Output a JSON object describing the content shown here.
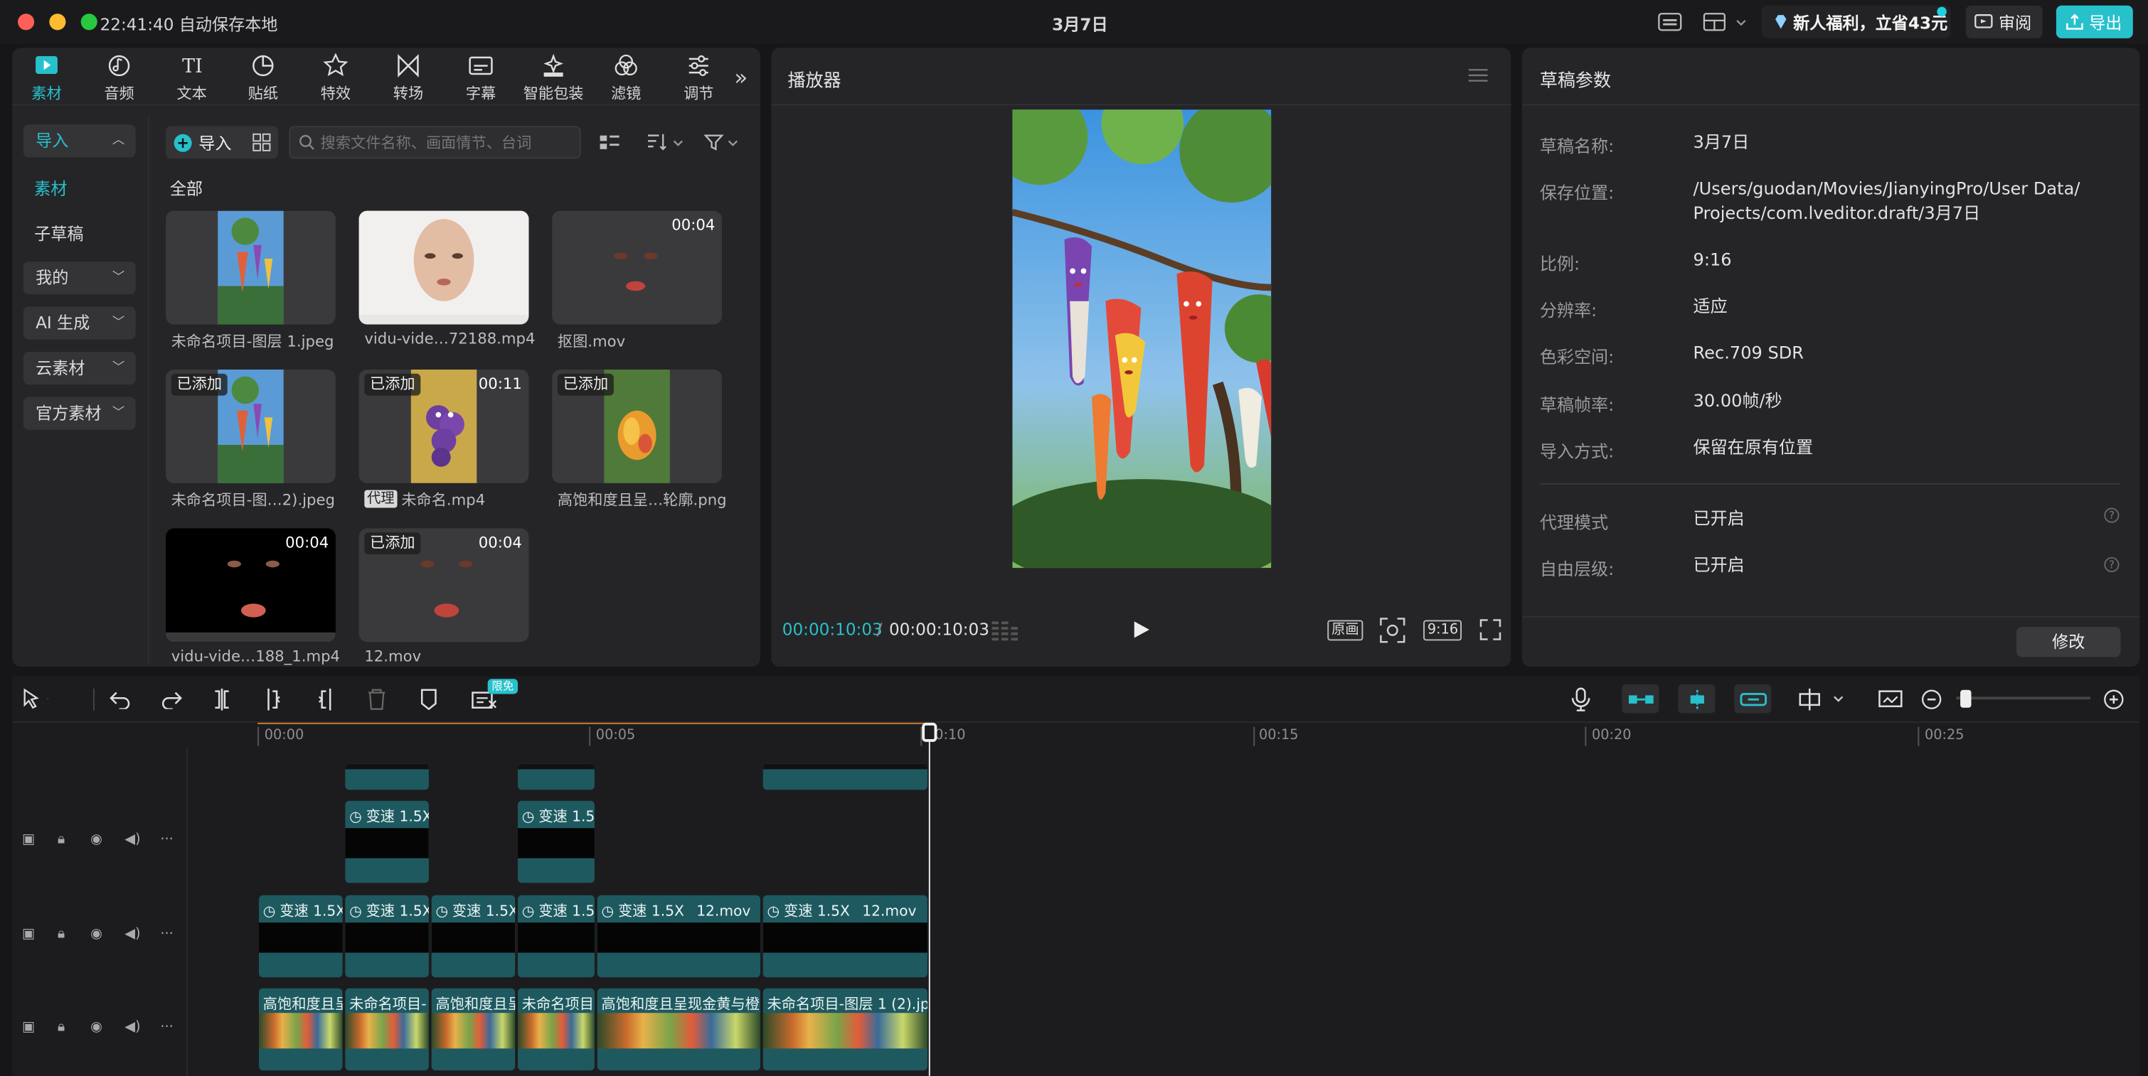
{
  "window": {
    "time_status": "22:41:40 自动保存本地",
    "title": "3月7日",
    "promo": "新人福利，立省43元",
    "review": "审阅",
    "export": "导出"
  },
  "toolbar": {
    "tabs": [
      {
        "label": "素材",
        "icon": "media-icon"
      },
      {
        "label": "音频",
        "icon": "audio-icon"
      },
      {
        "label": "文本",
        "icon": "text-icon"
      },
      {
        "label": "贴纸",
        "icon": "sticker-icon"
      },
      {
        "label": "特效",
        "icon": "effects-icon"
      },
      {
        "label": "转场",
        "icon": "transition-icon"
      },
      {
        "label": "字幕",
        "icon": "subtitle-icon"
      },
      {
        "label": "智能包装",
        "icon": "smart-package-icon"
      },
      {
        "label": "滤镜",
        "icon": "filter-icon"
      },
      {
        "label": "调节",
        "icon": "adjust-icon"
      }
    ],
    "active_tab": "素材",
    "more": "»"
  },
  "sidebar": {
    "items": [
      "导入",
      "素材",
      "子草稿",
      "我的",
      "AI 生成",
      "云素材",
      "官方素材"
    ]
  },
  "media": {
    "import_label": "导入",
    "search_placeholder": "搜索文件名称、画面情节、台词",
    "section": "全部",
    "items": [
      {
        "name": "未命名项目-图层 1.jpeg",
        "badge": "",
        "duration": ""
      },
      {
        "name": "vidu-vide…72188.mp4",
        "badge": "",
        "duration": ""
      },
      {
        "name": "抠图.mov",
        "badge": "",
        "duration": "00:04"
      },
      {
        "name": "未命名项目-图…2).jpeg",
        "badge": "已添加",
        "duration": ""
      },
      {
        "name": "未命名.mp4",
        "badge": "已添加",
        "duration": "00:11",
        "proxy": "代理"
      },
      {
        "name": "高饱和度且呈…轮廓.png",
        "badge": "已添加",
        "duration": ""
      },
      {
        "name": "vidu-vide…188_1.mp4",
        "badge": "",
        "duration": "00:04"
      },
      {
        "name": "12.mov",
        "badge": "已添加",
        "duration": "00:04"
      }
    ]
  },
  "player": {
    "title": "播放器",
    "current": "00:00:10:03",
    "separator": "/",
    "total": "00:00:10:03",
    "original": "原画",
    "ratio": "9:16"
  },
  "draft": {
    "title": "草稿参数",
    "props": [
      {
        "k": "草稿名称:",
        "v": "3月7日"
      },
      {
        "k": "保存位置:",
        "v": "/Users/guodan/Movies/JianyingPro/User Data/",
        "v2": "Projects/com.lveditor.draft/3月7日"
      },
      {
        "k": "比例:",
        "v": "9:16"
      },
      {
        "k": "分辨率:",
        "v": "适应"
      },
      {
        "k": "色彩空间:",
        "v": "Rec.709 SDR"
      },
      {
        "k": "草稿帧率:",
        "v": "30.00帧/秒"
      },
      {
        "k": "导入方式:",
        "v": "保留在原有位置"
      },
      {
        "k": "代理模式",
        "v": "已开启"
      },
      {
        "k": "自由层级:",
        "v": "已开启"
      }
    ],
    "help": "?",
    "modify": "修改"
  },
  "timeline": {
    "free_badge": "限免",
    "ruler": [
      "00:00",
      "00:05",
      "00:10",
      "00:15",
      "00:20",
      "00:25"
    ],
    "clips": {
      "speed": "变速 1.5X",
      "speed_short": "变速 1.5",
      "mov": "12.mov",
      "img1": "高饱和度且呈",
      "img2": "未命名项目-",
      "img3": "未命名项目",
      "img4": "高饱和度且呈现金黄与橙",
      "img5": "未命名项目-图层 1 (2).jp"
    }
  }
}
